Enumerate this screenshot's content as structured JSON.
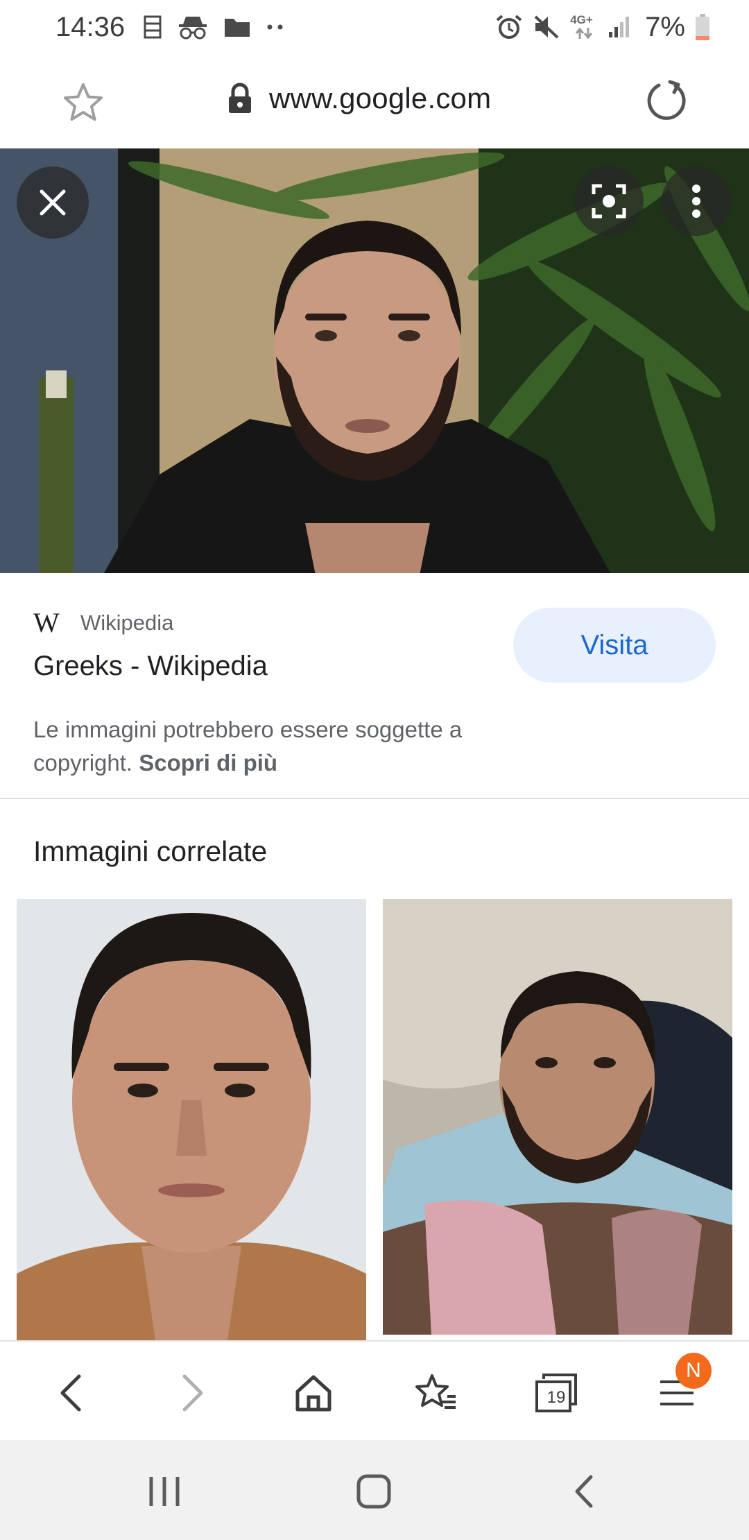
{
  "status_bar": {
    "time": "14:36",
    "network": "4G+",
    "battery": "7%",
    "left_icons": [
      "calendar-icon",
      "incognito-icon",
      "folder-icon",
      "more-dots-icon"
    ],
    "right_icons": [
      "alarm-icon",
      "mute-icon",
      "network-4g-icon",
      "signal-icon",
      "battery-icon"
    ]
  },
  "url_bar": {
    "url": "www.google.com",
    "icons": [
      "star-icon",
      "lock-icon",
      "reload-icon"
    ]
  },
  "image_viewer": {
    "icons": [
      "close-icon",
      "lens-icon",
      "more-vert-icon"
    ]
  },
  "source": {
    "logo": "W",
    "site": "Wikipedia",
    "title": "Greeks - Wikipedia",
    "visit_label": "Visita",
    "copyright_text": "Le immagini potrebbero essere soggette a copyright.",
    "learn_more": "Scopri di più"
  },
  "related": {
    "heading": "Immagini correlate"
  },
  "toolbar": {
    "tabs_count": "19",
    "menu_badge": "N",
    "icons": [
      "back-icon",
      "forward-icon",
      "home-icon",
      "bookmarks-icon",
      "tabs-icon",
      "menu-icon"
    ]
  },
  "system_nav": {
    "icons": [
      "recents-icon",
      "home-icon",
      "back-icon"
    ]
  },
  "colors": {
    "accent": "#1967d2",
    "visit_bg": "#e8f0fe",
    "badge": "#f26b1d",
    "battery_low": "#f08a6a"
  }
}
